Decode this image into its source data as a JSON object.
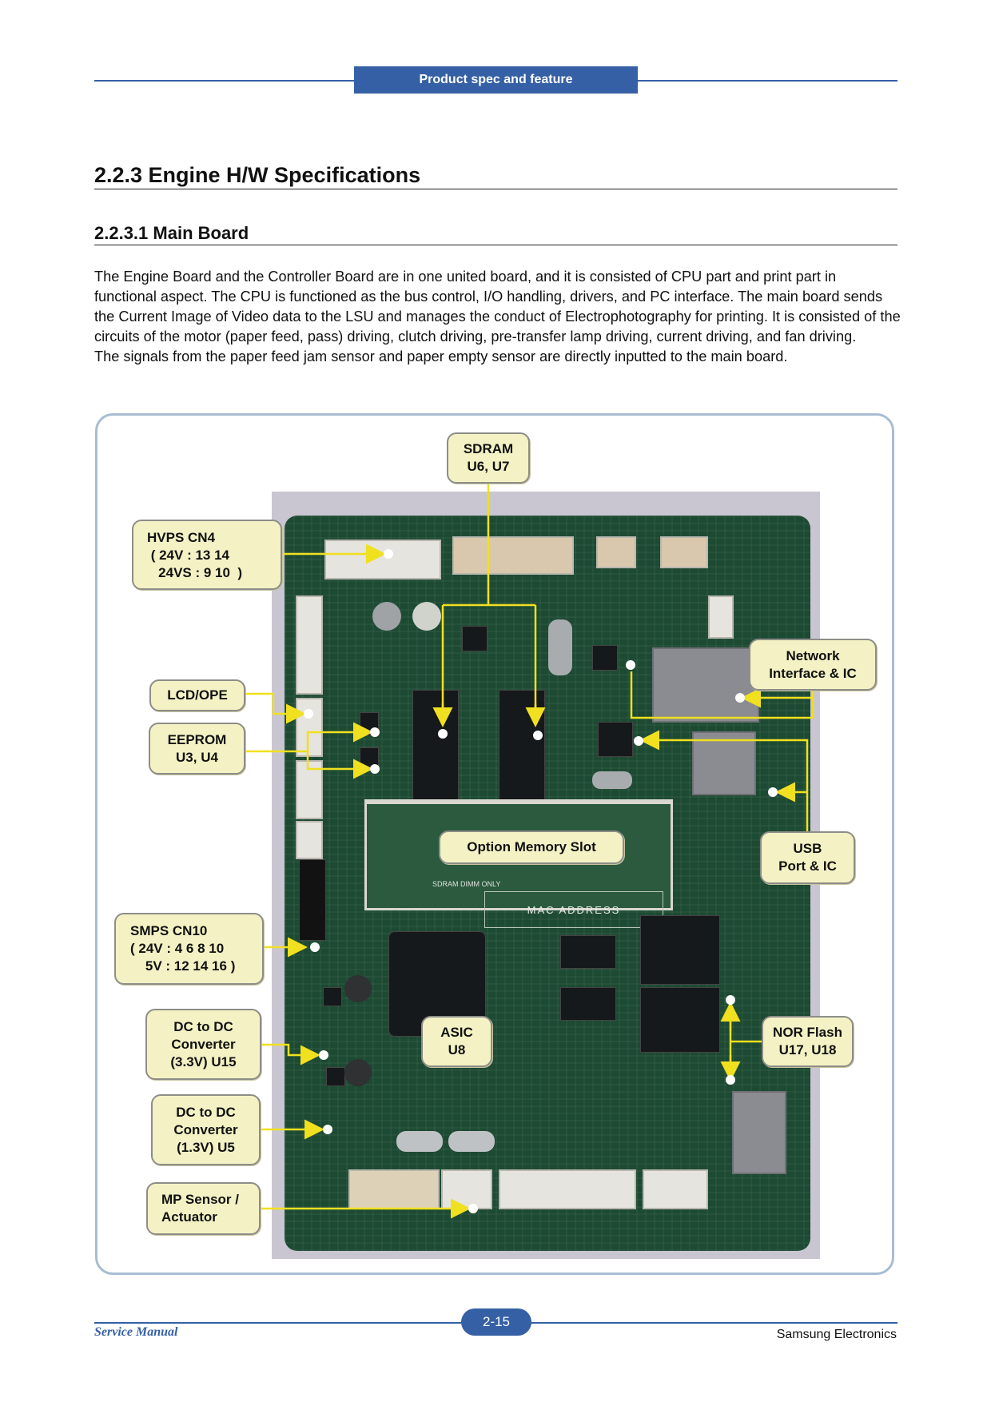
{
  "header": {
    "section_tab": "Product spec and feature"
  },
  "heading": "2.2.3 Engine H/W Specifications",
  "subheading": "2.2.3.1 Main Board",
  "body": {
    "paragraph_1": "The Engine Board and the Controller Board are in one united board, and it is consisted of CPU part and print part in functional aspect. The CPU is functioned as the bus control, I/O handling, drivers, and PC interface. The main board sends the Current Image of Video data to the LSU and manages the conduct of Electrophotography for printing. It is consisted of the circuits of the motor (paper feed, pass) driving, clutch driving, pre-transfer lamp driving, current driving, and fan driving.",
    "paragraph_2": "The signals from the paper feed jam sensor and paper empty sensor are directly inputted to the main board."
  },
  "figure": {
    "image_alt": "Main board photo",
    "callout_color": "#f4f2c4",
    "leader_color": "#f0e020",
    "callouts": {
      "sdram": "SDRAM\nU6, U7",
      "hvps": "HVPS CN4\n ( 24V : 13 14\n   24VS : 9 10  )",
      "network": "Network\nInterface & IC",
      "lcd": "LCD/OPE",
      "eeprom": "EEPROM\nU3, U4",
      "option_memory": "Option Memory Slot",
      "usb": "USB\nPort & IC",
      "smps": "SMPS CN10\n( 24V : 4 6 8 10\n    5V : 12 14 16 )",
      "asic": "ASIC\nU8",
      "nor_flash": "NOR Flash\nU17, U18",
      "dcdc_33": "DC to DC\nConverter\n(3.3V)  U15",
      "dcdc_13": "DC to DC\nConverter\n(1.3V)  U5",
      "mp_sensor": "MP Sensor /\nActuator"
    },
    "board_silkscreen": {
      "mac": "MAC ADDRESS",
      "sdram_dimm": "SDRAM DIMM ONLY"
    }
  },
  "footer": {
    "left": "Service Manual",
    "page": "2-15",
    "right": "Samsung Electronics"
  }
}
